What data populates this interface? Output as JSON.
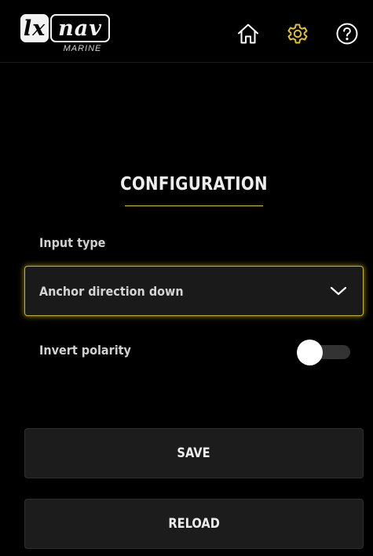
{
  "header": {
    "logo": {
      "primary": "lx",
      "secondary": "nav",
      "subtitle": "MARINE"
    },
    "nav": [
      {
        "icon": "home-icon"
      },
      {
        "icon": "gear-icon",
        "active": true
      },
      {
        "icon": "help-icon"
      }
    ]
  },
  "page": {
    "title": "CONFIGURATION"
  },
  "form": {
    "input_type_label": "Input type",
    "input_type_value": "Anchor direction down",
    "invert_polarity_label": "Invert polarity",
    "invert_polarity_on": false
  },
  "actions": {
    "save_label": "SAVE",
    "reload_label": "RELOAD"
  },
  "colors": {
    "accent": "#e1c31f",
    "background": "#000000",
    "surface": "#1c1c1c",
    "text": "#ededed"
  }
}
